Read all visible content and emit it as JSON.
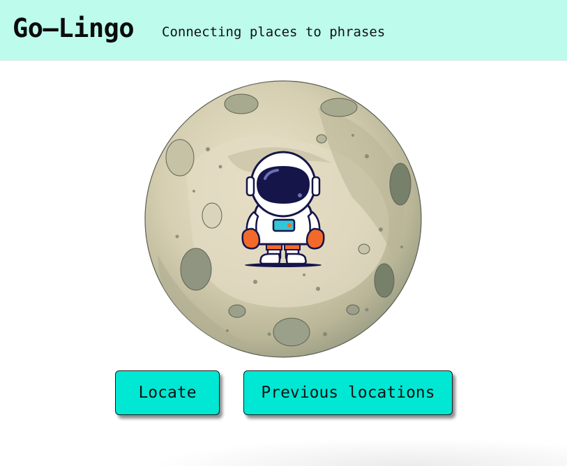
{
  "header": {
    "title": "Go–Lingo",
    "tagline": "Connecting places to phrases"
  },
  "hero": {
    "icon": "astronaut-on-moon-illustration"
  },
  "actions": {
    "locate_label": "Locate",
    "previous_label": "Previous locations"
  },
  "colors": {
    "header_bg": "#bdfcec",
    "button_bg": "#00e8d4",
    "moon_light": "#e4dcc2",
    "moon_mid": "#c9c2a4",
    "moon_dark": "#8e937b",
    "suit_navy": "#15154a",
    "suit_orange": "#f26a2a",
    "visor_teal": "#33c6d6"
  }
}
